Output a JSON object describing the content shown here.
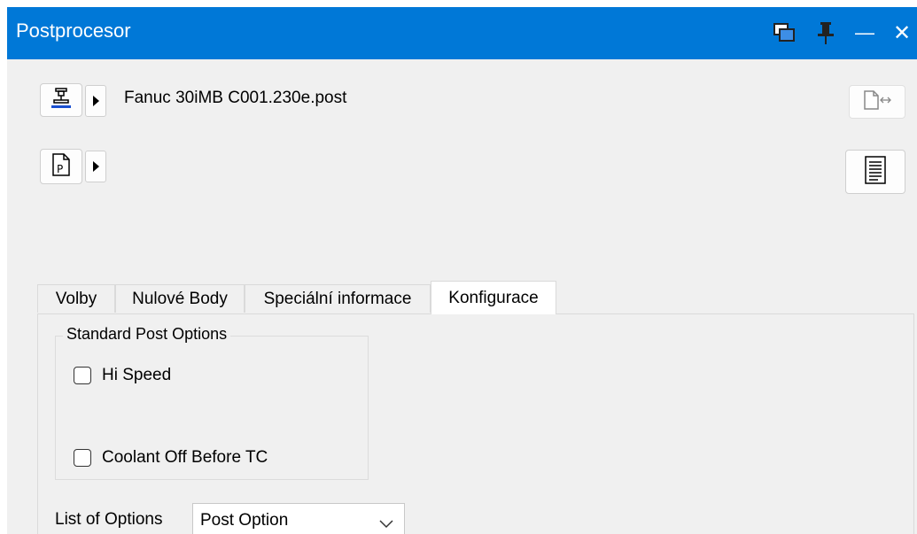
{
  "window": {
    "title": "Postprocesor"
  },
  "titlebar_icons": [
    "restore-window-icon",
    "pin-icon",
    "minimize-icon",
    "close-icon"
  ],
  "titlebar_symbols": {
    "minimize": "—",
    "close": "✕"
  },
  "post": {
    "filename": "Fanuc 30iMB C001.230e.post",
    "machine_icon": "machine-icon",
    "program_icon": "program-file-icon",
    "program_letter": "P"
  },
  "tabs": [
    {
      "label": "Volby",
      "active": false
    },
    {
      "label": "Nulové Body",
      "active": false
    },
    {
      "label": "Speciální informace",
      "active": false
    },
    {
      "label": "Konfigurace",
      "active": true
    }
  ],
  "config": {
    "group_title": "Standard Post Options",
    "options": [
      {
        "label": "Hi Speed",
        "checked": false
      },
      {
        "label": "Coolant Off Before TC",
        "checked": false
      }
    ],
    "list_label": "List of Options",
    "list_value": "Post Option"
  },
  "colors": {
    "titlebar": "#0078d7",
    "panel": "#f0f0f0"
  }
}
